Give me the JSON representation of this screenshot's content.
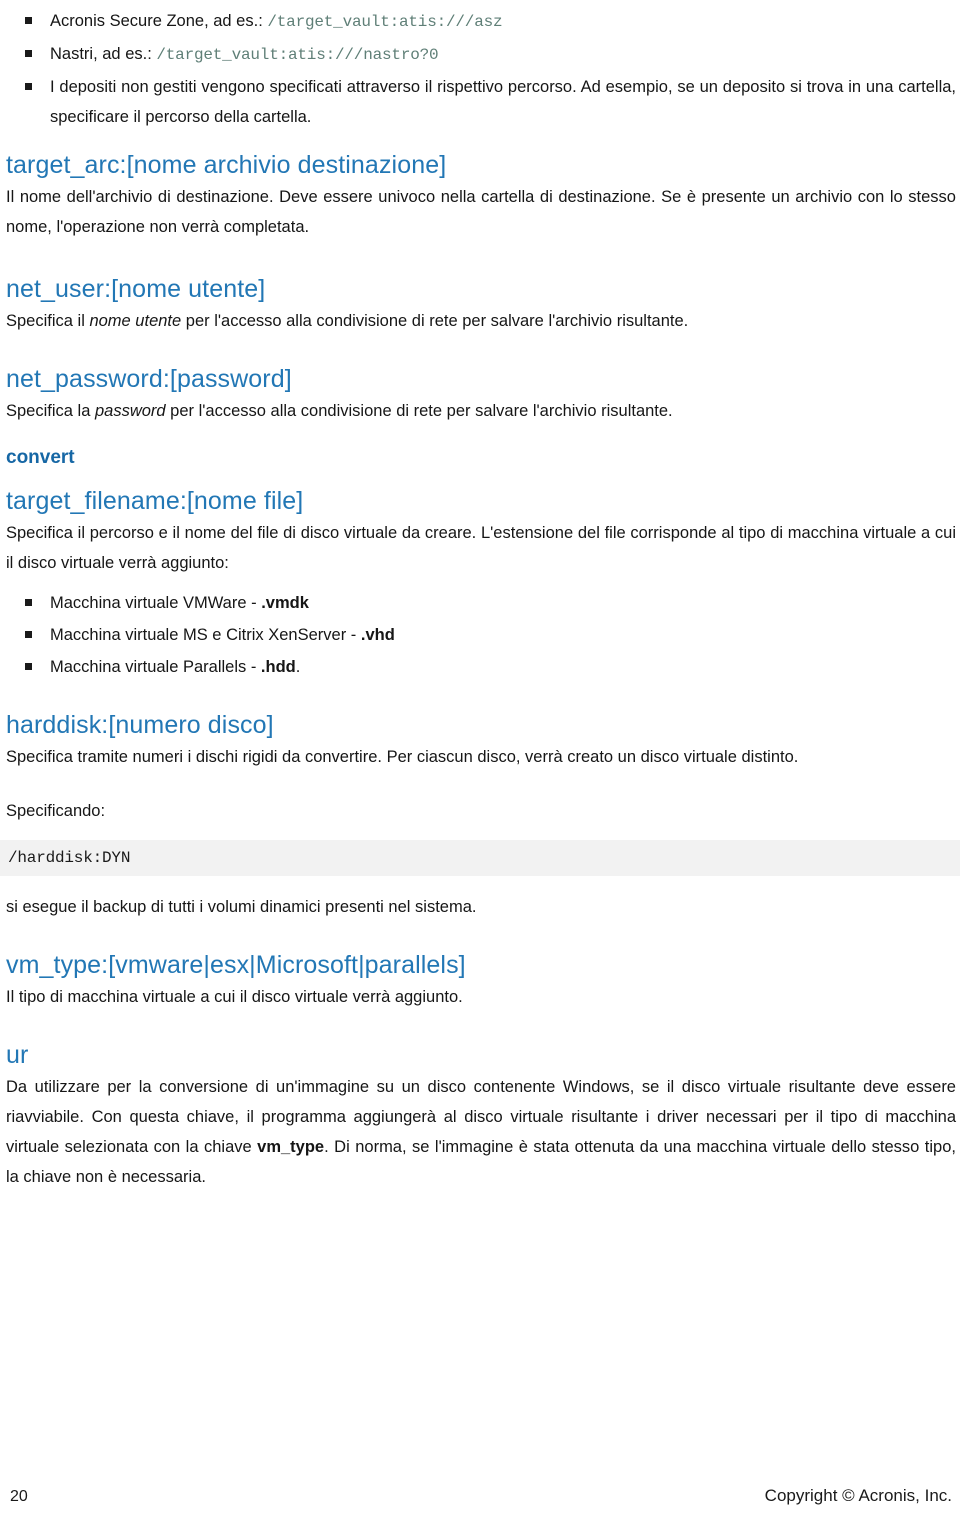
{
  "doc": {
    "intro_bullets": [
      {
        "lead": "Acronis Secure Zone, ad es.: ",
        "code": "/target_vault:atis:///asz"
      },
      {
        "lead": "Nastri, ad es.: ",
        "code": "/target_vault:atis:///nastro?0"
      }
    ],
    "paragraph_bullet": "I depositi non gestiti vengono specificati attraverso il rispettivo percorso. Ad esempio, se un deposito si trova in una cartella, specificare il percorso della cartella.",
    "sections": [
      {
        "id": "target-arc",
        "heading": "target_arc:[nome archivio destinazione]",
        "body": "Il nome dell'archivio di destinazione. Deve essere univoco nella cartella di destinazione. Se è presente un archivio con lo stesso nome, l'operazione non verrà completata."
      },
      {
        "id": "net-user",
        "heading": "net_user:[nome utente]",
        "body_pre": "Specifica il ",
        "body_em": "nome utente",
        "body_post": " per l'accesso alla condivisione di rete per salvare l'archivio risultante."
      },
      {
        "id": "net-password",
        "heading": "net_password:[password]",
        "body_pre": "Specifica la ",
        "body_em": "password",
        "body_post": " per l'accesso alla condivisione di rete per salvare l'archivio risultante."
      }
    ],
    "command_heading": "convert",
    "target_filename": {
      "heading": "target_filename:[nome file]",
      "body": "Specifica il percorso e il nome del file di disco virtuale da creare. L'estensione del file corrisponde al tipo di macchina virtuale a cui il disco virtuale verrà aggiunto:"
    },
    "vm_extension_bullets": [
      {
        "text": "Macchina virtuale VMWare - ",
        "ext": ".vmdk",
        "tail": ""
      },
      {
        "text": "Macchina virtuale MS e Citrix XenServer - ",
        "ext": ".vhd",
        "tail": ""
      },
      {
        "text": "Macchina virtuale Parallels - ",
        "ext": ".hdd",
        "tail": "."
      }
    ],
    "harddisk": {
      "heading": "harddisk:[numero disco]",
      "body": "Specifica tramite numeri i dischi rigidi da convertire. Per ciascun disco, verrà creato un disco virtuale distinto.",
      "specifying_label": "Specificando:",
      "code": "/harddisk:DYN",
      "after_code": "si esegue il backup di tutti i volumi dinamici presenti nel sistema."
    },
    "vm_type": {
      "heading": "vm_type:[vmware|esx|Microsoft|parallels]",
      "body": "Il tipo di macchina virtuale a cui il disco virtuale verrà aggiunto."
    },
    "ur": {
      "heading": "ur",
      "body_pre": "Da utilizzare per la conversione di un'immagine su un disco contenente Windows, se il disco virtuale risultante deve essere riavviabile. Con questa chiave, il programma aggiungerà al disco virtuale risultante i driver necessari per il tipo di macchina virtuale selezionata con la chiave ",
      "body_bold": "vm_type",
      "body_post": ". Di norma, se l'immagine è stata ottenuta da una macchina virtuale dello stesso tipo, la chiave non è necessaria."
    }
  },
  "footer": {
    "page_number": "20",
    "copyright": "Copyright © Acronis, Inc."
  },
  "colors": {
    "heading_blue": "#2277b5",
    "command_blue": "#1667a5",
    "mono_teal": "#5f7f77",
    "code_bg": "#f2f2f2",
    "text": "#161616"
  }
}
